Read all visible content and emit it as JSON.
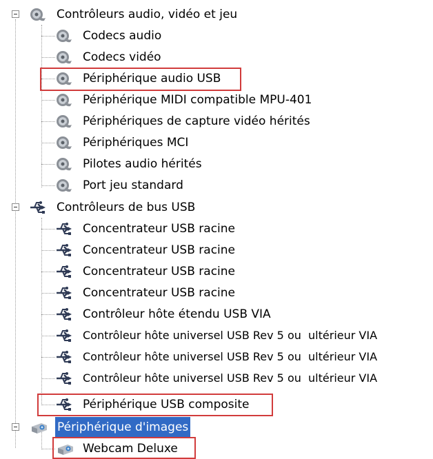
{
  "tree": {
    "categories": [
      {
        "label": "Contrôleurs audio, vidéo et jeu",
        "icon": "speaker-icon",
        "children": [
          "Codecs audio",
          "Codecs vidéo",
          "Périphérique audio USB",
          "Périphérique MIDI compatible MPU-401",
          "Périphériques de capture vidéo hérités",
          "Périphériques MCI",
          "Pilotes audio hérités",
          "Port jeu standard"
        ]
      },
      {
        "label": "Contrôleurs de bus USB",
        "icon": "usb-icon",
        "children": [
          "Concentrateur USB racine",
          "Concentrateur USB racine",
          "Concentrateur USB racine",
          "Concentrateur USB racine",
          "Contrôleur hôte étendu USB VIA",
          "Contrôleur hôte universel USB Rev 5 ou  ultérieur VIA",
          "Contrôleur hôte universel USB Rev 5 ou  ultérieur VIA",
          "Contrôleur hôte universel USB Rev 5 ou  ultérieur VIA",
          "Périphérique USB composite"
        ]
      },
      {
        "label": "Périphérique d'images",
        "icon": "camera-icon",
        "selected": true,
        "children": [
          "Webcam Deluxe"
        ]
      }
    ],
    "highlight_color": "#d13b3b",
    "selection_color": "#316ac5"
  }
}
